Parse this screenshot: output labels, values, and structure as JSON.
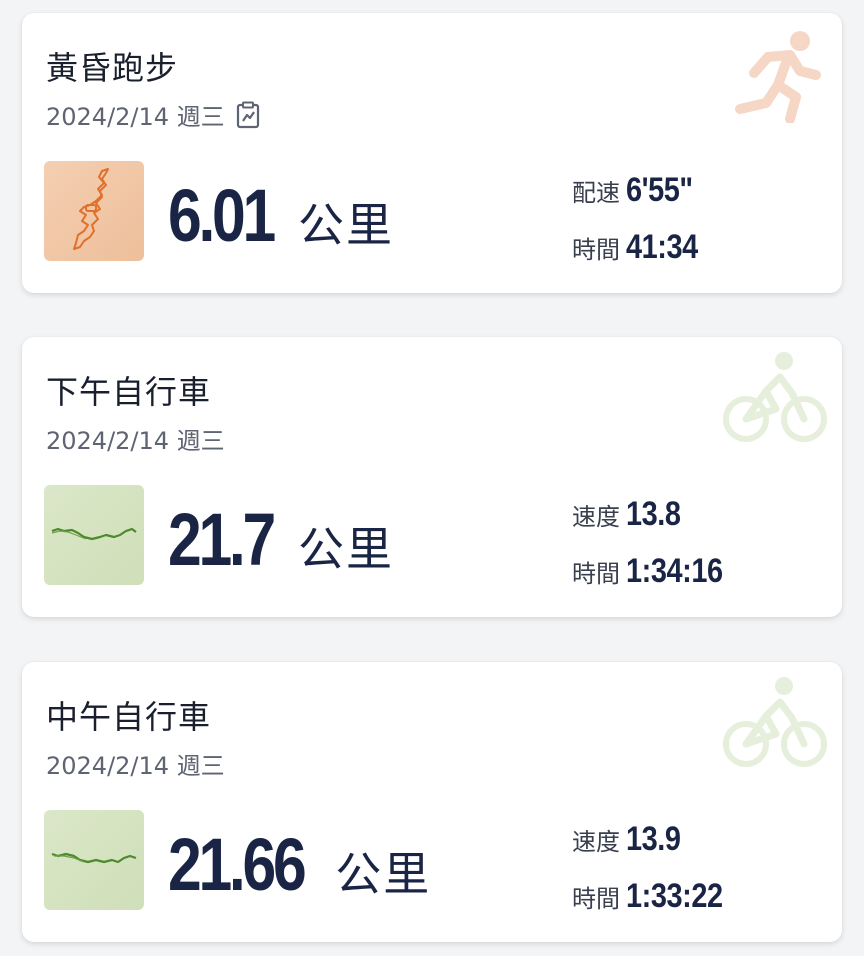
{
  "activities": [
    {
      "title": "黃昏跑步",
      "date": "2024/2/14 週三",
      "has_note": true,
      "sport_icon": "running-icon",
      "sport_icon_color": "#f6d7c6",
      "thumb_bg": "#f2c7a6",
      "route_color": "#e0702a",
      "distance": "6.01",
      "distance_unit": "公里",
      "stat1_label": "配速",
      "stat1_value": "6'55\"",
      "stat2_label": "時間",
      "stat2_value": "41:34"
    },
    {
      "title": "下午自行車",
      "date": "2024/2/14 週三",
      "has_note": false,
      "sport_icon": "cycling-icon",
      "sport_icon_color": "#e6efdc",
      "thumb_bg": "#d6e4c2",
      "route_color": "#4d8a2c",
      "distance": "21.7",
      "distance_unit": "公里",
      "stat1_label": "速度",
      "stat1_value": "13.8",
      "stat2_label": "時間",
      "stat2_value": "1:34:16"
    },
    {
      "title": "中午自行車",
      "date": "2024/2/14 週三",
      "has_note": false,
      "sport_icon": "cycling-icon",
      "sport_icon_color": "#e6efdc",
      "thumb_bg": "#d6e4c2",
      "route_color": "#4d8a2c",
      "distance": "21.66",
      "distance_unit": "公里",
      "stat1_label": "速度",
      "stat1_value": "13.9",
      "stat2_label": "時間",
      "stat2_value": "1:33:22"
    }
  ]
}
